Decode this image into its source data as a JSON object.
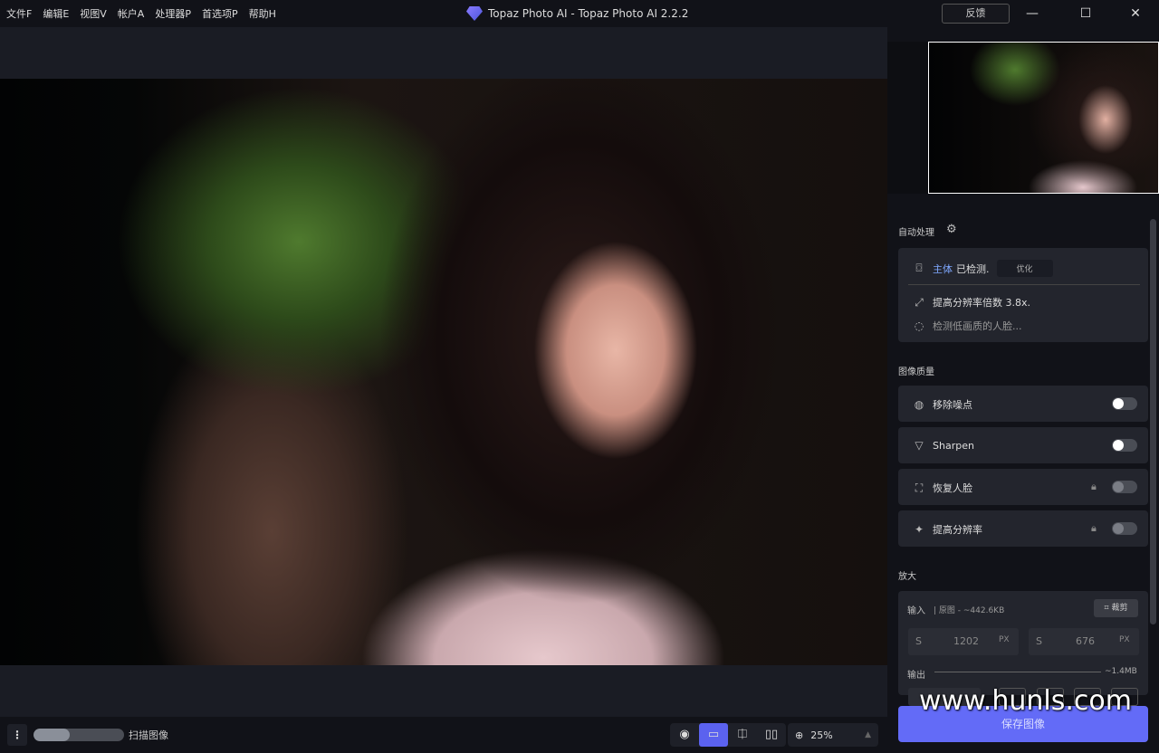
{
  "menu": [
    "文件F",
    "编辑E",
    "视图V",
    "帐户A",
    "处理器P",
    "首选项P",
    "帮助H"
  ],
  "window_title": "Topaz Photo AI - Topaz Photo AI 2.2.2",
  "feedback": "反馈",
  "statusbar": {
    "scan_label": "扫描图像",
    "scan_progress_percent": 40,
    "zoom": "25%",
    "view_mode": "single"
  },
  "autopilot": {
    "title": "自动处理",
    "subject_label": "主体",
    "detected": "已检测.",
    "refine": "优化",
    "upscale_text": "提高分辨率倍数 3.8x.",
    "detecting_faces": "检测低画质的人脸..."
  },
  "quality": {
    "title": "图像质量",
    "items": [
      {
        "label": "移除噪点",
        "on": false,
        "locked": false
      },
      {
        "label": "Sharpen",
        "on": false,
        "locked": false
      },
      {
        "label": "恢复人脸",
        "on": false,
        "locked": true
      },
      {
        "label": "提高分辨率",
        "on": false,
        "locked": true
      }
    ]
  },
  "upscale": {
    "title": "放大",
    "input_label": "输入",
    "input_info": "| 原图 - ~442.6KB",
    "crop": "裁剪",
    "width_prefix": "S",
    "width": "1202",
    "height_prefix": "S",
    "height": "676",
    "unit": "PX",
    "output_label": "输出",
    "output_size": "~1.4MB"
  },
  "save": "保存图像",
  "watermark": "www.hunls.com",
  "accent": "#636bf7"
}
